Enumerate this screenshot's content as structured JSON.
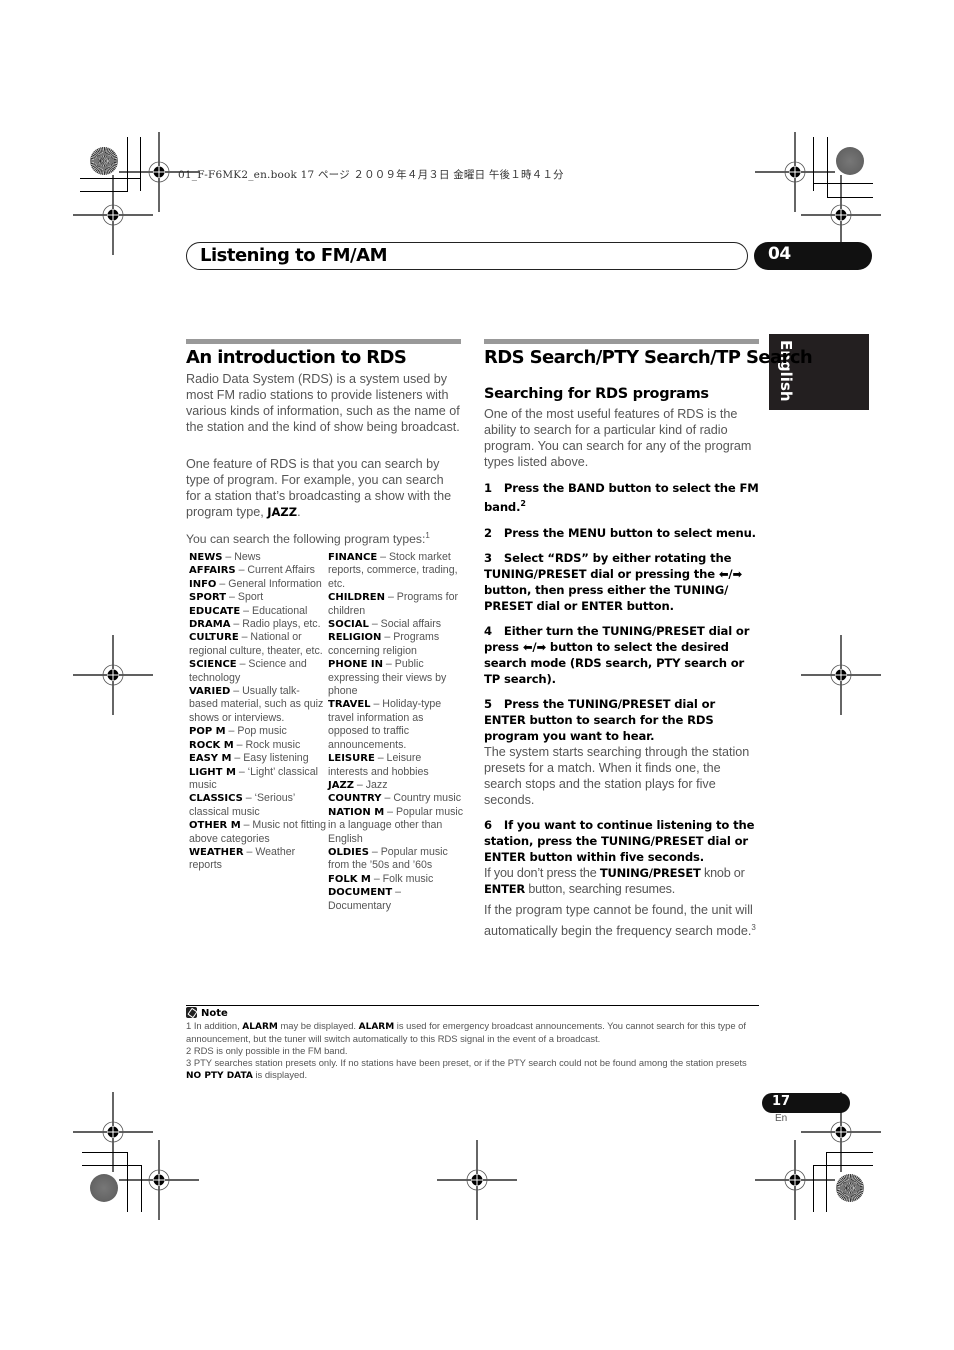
{
  "print_header": "01_F-F6MK2_en.book  17 ページ  ２００９年４月３日  金曜日  午後１時４１分",
  "chapter": {
    "title": "Listening to FM/AM",
    "number": "04"
  },
  "language_tab": "English",
  "left": {
    "heading": "An introduction to RDS",
    "para1": "Radio Data System (RDS) is a system used by most FM radio stations to provide listeners with various kinds of information, such as the name of the station and the kind of show being broadcast.",
    "para2_prefix": "One feature of RDS is that you can search by type of program. For example, you can search for a station that’s broadcasting a show with the program type, ",
    "para2_bold": "JAZZ",
    "para2_suffix": ".",
    "types_intro": "You can search the following program types:",
    "types_intro_sup": "1",
    "program_types_col1": [
      {
        "code": "NEWS",
        "desc": "News"
      },
      {
        "code": "AFFAIRS",
        "desc": "Current Affairs"
      },
      {
        "code": "INFO",
        "desc": "General Information"
      },
      {
        "code": "SPORT",
        "desc": "Sport"
      },
      {
        "code": "EDUCATE",
        "desc": "Educational"
      },
      {
        "code": "DRAMA",
        "desc": "Radio plays, etc."
      },
      {
        "code": "CULTURE",
        "desc": "National or regional culture, theater, etc."
      },
      {
        "code": "SCIENCE",
        "desc": "Science and technology"
      },
      {
        "code": "VARIED",
        "desc": "Usually talk-based material, such as quiz shows or interviews."
      },
      {
        "code": "POP M",
        "desc": "Pop music"
      },
      {
        "code": "ROCK M",
        "desc": "Rock music"
      },
      {
        "code": "EASY M",
        "desc": "Easy listening"
      },
      {
        "code": "LIGHT M",
        "desc": "‘Light’ classical music"
      },
      {
        "code": "CLASSICS",
        "desc": "‘Serious’ classical music"
      },
      {
        "code": "OTHER M",
        "desc": "Music not fitting above categories"
      },
      {
        "code": "WEATHER",
        "desc": "Weather reports"
      }
    ],
    "program_types_col2": [
      {
        "code": "FINANCE",
        "desc": "Stock market reports, commerce, trading, etc."
      },
      {
        "code": "CHILDREN",
        "desc": "Programs for children"
      },
      {
        "code": "SOCIAL",
        "desc": "Social affairs"
      },
      {
        "code": "RELIGION",
        "desc": "Programs concerning religion"
      },
      {
        "code": "PHONE IN",
        "desc": "Public expressing their views by phone"
      },
      {
        "code": "TRAVEL",
        "desc": "Holiday-type travel information as opposed to traffic announcements."
      },
      {
        "code": "LEISURE",
        "desc": "Leisure interests and hobbies"
      },
      {
        "code": "JAZZ",
        "desc": "Jazz"
      },
      {
        "code": "COUNTRY",
        "desc": "Country music"
      },
      {
        "code": "NATION M",
        "desc": "Popular music in a language other than English"
      },
      {
        "code": "OLDIES",
        "desc": "Popular music from the ’50s and ’60s"
      },
      {
        "code": "FOLK M",
        "desc": "Folk music"
      },
      {
        "code": "DOCUMENT",
        "desc": "Documentary"
      }
    ]
  },
  "right": {
    "heading": "RDS Search/PTY Search/TP Search",
    "subheading": "Searching for RDS programs",
    "intro": "One of the most useful features of RDS is the ability to search for a particular kind of radio program. You can search for any of the program types listed above.",
    "steps": [
      {
        "num": "1",
        "text": "Press the BAND button to select the FM band.",
        "sup": "2"
      },
      {
        "num": "2",
        "text": "Press the MENU button to select menu."
      },
      {
        "num": "3",
        "text": "Select “RDS” by either rotating the TUNING/PRESET dial or pressing the ⬅/➡ button, then press either the TUNING/ PRESET dial or ENTER button."
      },
      {
        "num": "4",
        "text": "Either turn the TUNING/PRESET dial or press ⬅/➡ button to select the  desired search mode (RDS search, PTY search or TP search)."
      },
      {
        "num": "5",
        "text": "Press the TUNING/PRESET dial or ENTER button to search for the RDS program you want to hear."
      },
      {
        "num": "6",
        "text": "If you want to continue listening to the station, press the TUNING/PRESET dial or ENTER button within five seconds."
      }
    ],
    "step5_body": "The system starts searching through the station presets for a match. When it finds one, the search stops and the station plays for five seconds.",
    "step6_body_1": "If you don’t press the ",
    "step6_body_b1": "TUNING/PRESET",
    "step6_body_2": " knob or ",
    "step6_body_b2": "ENTER",
    "step6_body_3": " button, searching resumes.",
    "final_para": "If the program type cannot be found, the unit will automatically begin the frequency search mode.",
    "final_sup": "3"
  },
  "notes": {
    "heading": "Note",
    "n1_a": "1 In addition, ",
    "n1_b1": "ALARM",
    "n1_c": " may be displayed. ",
    "n1_b2": "ALARM",
    "n1_d": " is used for emergency broadcast announcements. You cannot search for this type of announcement, but the tuner will switch automatically to this RDS signal in the event of a broadcast.",
    "n2": "2 RDS is only possible in the FM band.",
    "n3_a": "3 PTY searches station presets only. If no stations have been preset, or if the PTY search could not be found among the station presets ",
    "n3_b": "NO PTY DATA",
    "n3_c": " is displayed."
  },
  "footer": {
    "page_number": "17",
    "lang_code": "En"
  }
}
